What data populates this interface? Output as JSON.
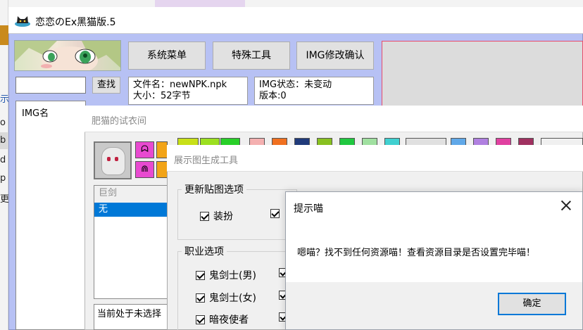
{
  "background_app": {
    "letters": [
      "o",
      "b",
      "d",
      "p",
      "更"
    ],
    "side_mark": "示"
  },
  "main_window": {
    "title": "恋恋のEx黑猫版.5",
    "buttons": {
      "system_menu": "系统菜单",
      "special_tools": "特殊工具",
      "img_confirm": "IMG修改确认"
    },
    "search": {
      "button": "查找",
      "value": ""
    },
    "file_info": {
      "name_line": "文件名：newNPK.npk",
      "size_line": "大小：52字节"
    },
    "img_info": {
      "status_line": "IMG状态：未变动",
      "version_line": "版本:0"
    },
    "img_list_header": "IMG名"
  },
  "fitting_room": {
    "title": "肥猫的试衣间",
    "category_header": "巨剑",
    "selected_item": "无",
    "status_text": "当前处于未选择"
  },
  "showcase_tool": {
    "title": "展示图生成工具",
    "update_group_label": "更新贴图选项",
    "update_options": [
      "装扮"
    ],
    "job_group_label": "职业选项",
    "jobs": [
      "鬼剑士(男)",
      "鬼剑士(女)",
      "暗夜使者"
    ]
  },
  "alert": {
    "title": "提示喵",
    "message": "嗯喵？找不到任何资源喵！查看资源目录是否设置完毕喵！",
    "ok_label": "确定"
  },
  "colors": {
    "main_bg": "#b7c1f4",
    "selection": "#0078d7",
    "preview_border": "#e84c6c"
  }
}
